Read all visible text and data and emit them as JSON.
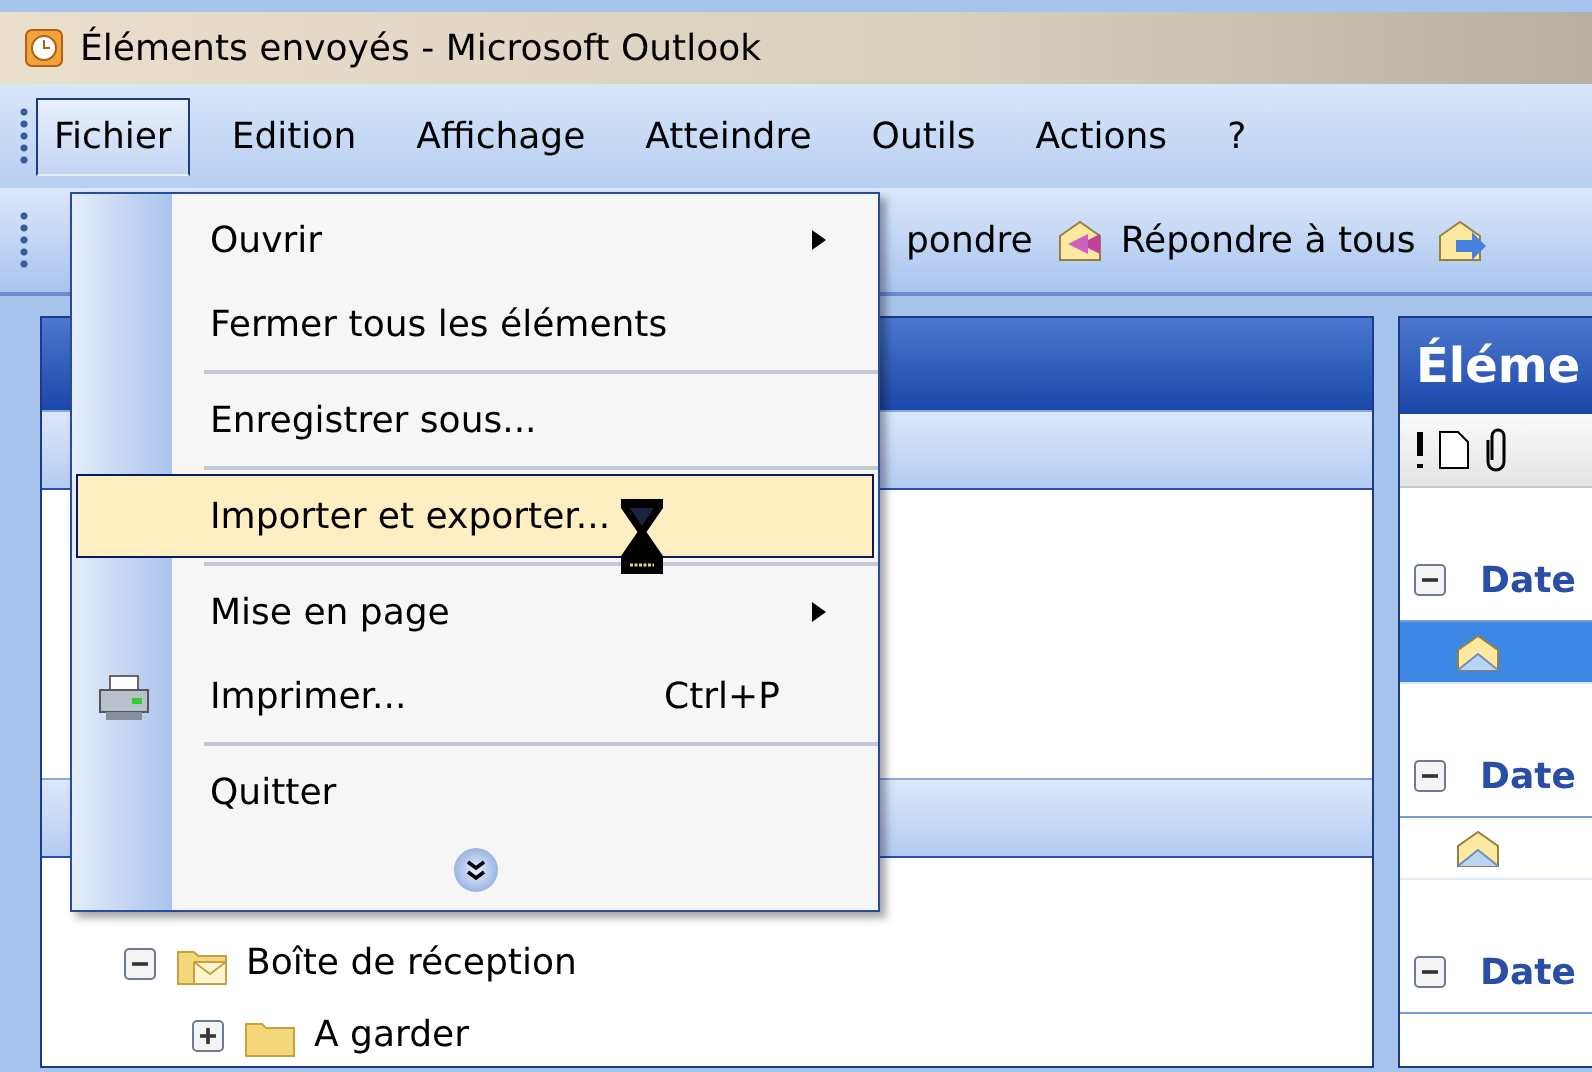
{
  "window": {
    "title": "Éléments envoyés - Microsoft Outlook"
  },
  "menu_bar": [
    {
      "label": "Fichier",
      "selected": true
    },
    {
      "label": "Edition",
      "selected": false
    },
    {
      "label": "Affichage",
      "selected": false
    },
    {
      "label": "Atteindre",
      "selected": false
    },
    {
      "label": "Outils",
      "selected": false
    },
    {
      "label": "Actions",
      "selected": false
    },
    {
      "label": "?",
      "selected": false
    }
  ],
  "toolbar": {
    "buttons": [
      {
        "label": "pondre",
        "kind": "reply"
      },
      {
        "label": "Répondre à tous",
        "kind": "reply-all"
      },
      {
        "kind": "forward"
      }
    ]
  },
  "file_menu": {
    "items": [
      {
        "label": "Ouvrir",
        "submenu": true,
        "highlighted": false,
        "separator_before": false,
        "printer_icon": false
      },
      {
        "label": "Fermer tous les éléments",
        "submenu": false,
        "highlighted": false,
        "separator_before": false,
        "printer_icon": false
      },
      {
        "label": "Enregistrer sous...",
        "submenu": false,
        "highlighted": false,
        "separator_before": true,
        "printer_icon": false
      },
      {
        "label": "Importer et exporter...",
        "submenu": false,
        "highlighted": true,
        "separator_before": true,
        "printer_icon": false
      },
      {
        "label": "Mise en page",
        "submenu": true,
        "highlighted": false,
        "separator_before": true,
        "printer_icon": false
      },
      {
        "label": "Imprimer...",
        "shortcut": "Ctrl+P",
        "submenu": false,
        "highlighted": false,
        "separator_before": false,
        "printer_icon": true
      },
      {
        "label": "Quitter",
        "submenu": false,
        "highlighted": false,
        "separator_before": true,
        "printer_icon": false
      }
    ]
  },
  "folder_tree": [
    {
      "label": "Boîte de réception",
      "expanded": true,
      "children": [
        {
          "label": "A garder",
          "expanded": false
        }
      ]
    }
  ],
  "mail_pane": {
    "title": "Éléme",
    "groups": [
      {
        "label": "Date",
        "expanded": true,
        "rows": [
          {
            "selected": true
          }
        ]
      },
      {
        "label": "Date",
        "expanded": true,
        "rows": [
          {
            "selected": false
          }
        ]
      },
      {
        "label": "Date",
        "expanded": true
      }
    ]
  }
}
